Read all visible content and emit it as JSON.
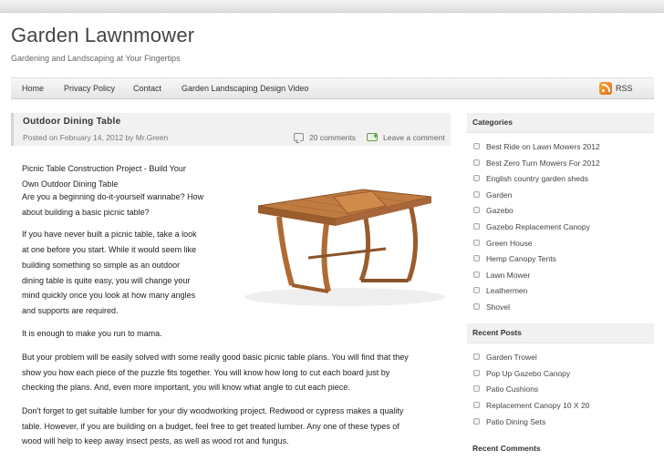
{
  "site": {
    "title": "Garden Lawnmower",
    "tagline": "Gardening and Landscaping at Your Fingertips"
  },
  "nav": {
    "items": [
      "Home",
      "Privacy Policy",
      "Contact",
      "Garden Landscaping Design Video"
    ],
    "rss_label": "RSS"
  },
  "post": {
    "title": "Outdoor Dining Table",
    "meta": "Posted on February 14, 2012 by Mr.Green",
    "comments_count": "20 comments",
    "leave_comment": "Leave a comment",
    "paragraphs": [
      "Picnic Table Construction Project - Build Your",
      "Own Outdoor Dining Table",
      "Are you a beginning do-it-yourself wannabe? How",
      "about building a basic picnic table?",
      "If you have never built a picnic table, take a look",
      "at one before you start. While it would seem like",
      "building something so simple as an outdoor",
      "dining table is quite easy, you will change your",
      "mind quickly once you look at how many angles",
      "and supports are required.",
      "It is enough to make you run to mama.",
      "But your problem will be easily solved with some really good basic picnic table plans. You will find that they",
      "show you how each piece of the puzzle fits together. You will know how long to cut each board just by",
      "checking the plans. And, even more important, you will know what angle to cut each piece.",
      "Don't forget to get suitable lumber for your diy woodworking project. Redwood or cypress makes a quality",
      "table. However, if you are building on a budget, feel free to get treated lumber. Any one of these types of",
      "wood will help to keep away insect pests, as well as wood rot and fungus."
    ]
  },
  "sidebar": {
    "categories_title": "Categories",
    "categories": [
      "Best Ride on Lawn Mowers 2012",
      "Best Zero Turn Mowers For 2012",
      "English country garden sheds",
      "Garden",
      "Gazebo",
      "Gazebo Replacement Canopy",
      "Green House",
      "Hemp Canopy Tents",
      "Lawn Mower",
      "Leathermen",
      "Shovel"
    ],
    "recent_posts_title": "Recent Posts",
    "recent_posts": [
      "Garden Trowel",
      "Pop Up Gazebo Canopy",
      "Patio Cushions",
      "Replacement Canopy 10 X 20",
      "Patio Dining Sets"
    ],
    "recent_comments_title": "Recent Comments"
  },
  "colors": {
    "wood": "#b8743c",
    "wood_dark": "#8a5228",
    "rss": "#e0701a"
  }
}
